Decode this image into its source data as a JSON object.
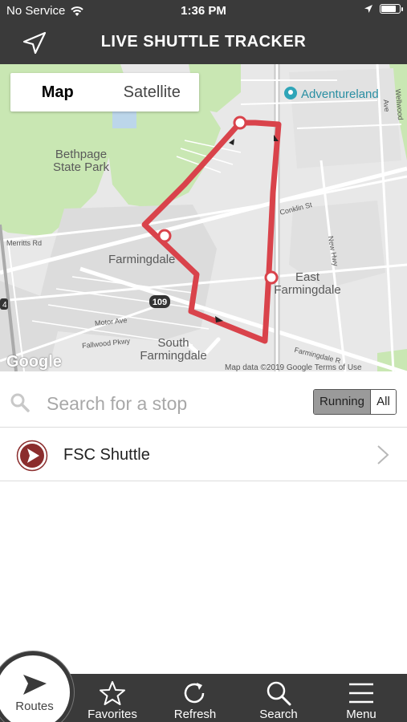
{
  "status_bar": {
    "carrier": "No Service",
    "time": "1:36 PM",
    "battery_level": 0.75
  },
  "header": {
    "title": "LIVE SHUTTLE TRACKER",
    "locate_icon": "location-arrow-icon"
  },
  "map": {
    "toggle": {
      "options": [
        "Map",
        "Satellite"
      ],
      "selected": "Map"
    },
    "labels": {
      "adventureland": "Adventureland",
      "bethpage": "Bethpage\nState Park",
      "farmingdale": "Farmingdale",
      "east_farmingdale": "East\nFarmingdale",
      "south_farmingdale": "South\nFarmingdale",
      "conklin": "Conklin St",
      "merritts": "Merritts Rd",
      "motor": "Motor Ave",
      "fallwood": "Fallwood Pkwy",
      "new_hwy": "New Hwy",
      "wellwood": "Wellwood Ave",
      "farmingdale_rd": "Farmingdale R",
      "route_109": "109",
      "route_4": "4"
    },
    "google_logo": "Google",
    "footer": "Map data ©2019 Google   Terms of Use",
    "route_color": "#d9434b"
  },
  "search": {
    "placeholder": "Search for a stop",
    "value": "",
    "filters": [
      "Running",
      "All"
    ],
    "selected_filter": "Running"
  },
  "routes": [
    {
      "name": "FSC Shuttle",
      "icon": "play-circle-icon",
      "color": "#8b2d2d"
    }
  ],
  "tabs": [
    {
      "label": "Routes",
      "icon": "navigation-arrow-icon",
      "active": true
    },
    {
      "label": "Favorites",
      "icon": "star-icon",
      "active": false
    },
    {
      "label": "Refresh",
      "icon": "refresh-icon",
      "active": false
    },
    {
      "label": "Search",
      "icon": "search-icon",
      "active": false
    },
    {
      "label": "Menu",
      "icon": "menu-icon",
      "active": false
    }
  ]
}
